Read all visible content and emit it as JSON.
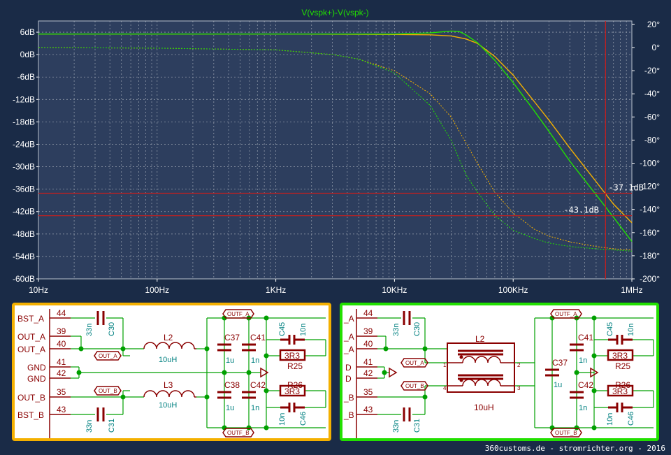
{
  "chart_data": {
    "type": "line",
    "title": "V(vspk+)-V(vspk-)",
    "x_scale": "log",
    "xlim": [
      10,
      1000000
    ],
    "x_ticks": [
      {
        "value": 10,
        "label": "10Hz"
      },
      {
        "value": 100,
        "label": "100Hz"
      },
      {
        "value": 1000,
        "label": "1KHz"
      },
      {
        "value": 10000,
        "label": "10KHz"
      },
      {
        "value": 100000,
        "label": "100KHz"
      },
      {
        "value": 1000000,
        "label": "1MHz"
      }
    ],
    "ylim": [
      -60,
      9
    ],
    "y_ticks": [
      {
        "value": 6,
        "label": "6dB"
      },
      {
        "value": 0,
        "label": "0dB"
      },
      {
        "value": -6,
        "label": "-6dB"
      },
      {
        "value": -12,
        "label": "-12dB"
      },
      {
        "value": -18,
        "label": "-18dB"
      },
      {
        "value": -24,
        "label": "-24dB"
      },
      {
        "value": -30,
        "label": "-30dB"
      },
      {
        "value": -36,
        "label": "-36dB"
      },
      {
        "value": -42,
        "label": "-42dB"
      },
      {
        "value": -48,
        "label": "-48dB"
      },
      {
        "value": -54,
        "label": "-54dB"
      },
      {
        "value": -60,
        "label": "-60dB"
      }
    ],
    "y2lim": [
      -200,
      23
    ],
    "y2_ticks": [
      {
        "value": 20,
        "label": "20°"
      },
      {
        "value": 0,
        "label": "0°"
      },
      {
        "value": -20,
        "label": "-20°"
      },
      {
        "value": -40,
        "label": "-40°"
      },
      {
        "value": -60,
        "label": "-60°"
      },
      {
        "value": -80,
        "label": "-80°"
      },
      {
        "value": -100,
        "label": "-100°"
      },
      {
        "value": -120,
        "label": "-120°"
      },
      {
        "value": -140,
        "label": "-140°"
      },
      {
        "value": -160,
        "label": "-160°"
      },
      {
        "value": -180,
        "label": "-180°"
      },
      {
        "value": -200,
        "label": "-200°"
      }
    ],
    "grid": true,
    "series": [
      {
        "color": "#f4b000",
        "style": "solid",
        "axis": "magnitude",
        "x": [
          10,
          1000,
          10000,
          20000,
          30000,
          40000,
          50000,
          70000,
          100000,
          150000,
          200000,
          300000,
          500000,
          700000,
          1000000
        ],
        "y": [
          5.5,
          5.5,
          5.4,
          5.3,
          5.0,
          4.2,
          3.0,
          -0.5,
          -5.5,
          -12.5,
          -17.5,
          -25,
          -34,
          -40,
          -45
        ]
      },
      {
        "color": "#22e000",
        "style": "solid",
        "axis": "magnitude",
        "x": [
          10,
          1000,
          10000,
          20000,
          30000,
          35000,
          40000,
          50000,
          70000,
          100000,
          150000,
          200000,
          300000,
          500000,
          700000,
          1000000
        ],
        "y": [
          5.5,
          5.5,
          5.5,
          5.8,
          6.3,
          6.2,
          5.3,
          3.2,
          -1.5,
          -7.5,
          -15,
          -20.5,
          -28.5,
          -37.5,
          -43.5,
          -50
        ]
      },
      {
        "color": "#f4b000",
        "style": "dashed",
        "axis": "phase",
        "x": [
          10,
          100,
          1000,
          3000,
          5000,
          10000,
          20000,
          30000,
          50000,
          70000,
          100000,
          150000,
          200000,
          300000,
          500000,
          700000,
          1000000
        ],
        "y": [
          0,
          -0.5,
          -2,
          -6,
          -10,
          -20,
          -40,
          -60,
          -100,
          -125,
          -143,
          -157,
          -163,
          -168,
          -172,
          -174,
          -175
        ]
      },
      {
        "color": "#22e000",
        "style": "dashed",
        "axis": "phase",
        "x": [
          10,
          100,
          1000,
          3000,
          5000,
          10000,
          20000,
          30000,
          40000,
          50000,
          70000,
          100000,
          150000,
          200000,
          300000,
          500000,
          700000,
          1000000
        ],
        "y": [
          0,
          -0.5,
          -2,
          -6,
          -10,
          -22,
          -50,
          -80,
          -110,
          -125,
          -145,
          -158,
          -165,
          -169,
          -172,
          -174,
          -175,
          -176
        ]
      }
    ],
    "cursor_x": 600000,
    "cursors_y": [
      {
        "value": -37.1,
        "label": "-37.1dB"
      },
      {
        "value": -43.1,
        "label": "-43.1dB"
      }
    ]
  },
  "theme": {
    "background": "#1a2b47",
    "plot_background": "#2d3e5e",
    "grid": "#8e98a8",
    "cursor": "#c02020",
    "title": "#22e000"
  },
  "schematic_left": {
    "pins": [
      {
        "num": "44",
        "label": "BST_A"
      },
      {
        "num": "39",
        "label": "OUT_A"
      },
      {
        "num": "40",
        "label": "OUT_A"
      },
      {
        "num": "41",
        "label": "GND"
      },
      {
        "num": "42",
        "label": "GND"
      },
      {
        "num": "35",
        "label": "OUT_B"
      },
      {
        "num": "43",
        "label": "BST_B"
      }
    ],
    "L2": {
      "ref": "L2",
      "value": "10uH"
    },
    "L3": {
      "ref": "L3",
      "value": "10uH"
    },
    "C30": {
      "ref": "C30",
      "value": "33n"
    },
    "C31": {
      "ref": "C31",
      "value": "33n"
    },
    "C37": {
      "ref": "C37",
      "value": "1u"
    },
    "C38": {
      "ref": "C38",
      "value": "1u"
    },
    "C41": {
      "ref": "C41",
      "value": "1n"
    },
    "C42": {
      "ref": "C42",
      "value": "1n"
    },
    "C45": {
      "ref": "C45",
      "value": "10n"
    },
    "C46": {
      "ref": "C46",
      "value": "10n"
    },
    "R25": {
      "ref": "R25",
      "value": "3R3"
    },
    "R26": {
      "ref": "R26",
      "value": "3R3"
    },
    "tags": {
      "outf_a": "OUTF_A",
      "outf_b": "OUTF_B",
      "out_a": "OUT_A",
      "out_b": "OUT_B"
    }
  },
  "schematic_right": {
    "pins": [
      {
        "num": "44",
        "label": "_A"
      },
      {
        "num": "39",
        "label": "_A"
      },
      {
        "num": "40",
        "label": "_A"
      },
      {
        "num": "41",
        "label": "D"
      },
      {
        "num": "42",
        "label": "D"
      },
      {
        "num": "35",
        "label": "_B"
      },
      {
        "num": "43",
        "label": "_B"
      }
    ],
    "L2": {
      "ref": "L2",
      "value": "10uH",
      "pin1": "1",
      "pin2": "2",
      "pin3": "3",
      "pin4": "4"
    },
    "C30": {
      "ref": "C30",
      "value": "33n"
    },
    "C31": {
      "ref": "C31",
      "value": "33n"
    },
    "C37": {
      "ref": "C37",
      "value": "1u"
    },
    "C41": {
      "ref": "C41",
      "value": "1n"
    },
    "C42": {
      "ref": "C42",
      "value": "1n"
    },
    "C45": {
      "ref": "C45",
      "value": "10n"
    },
    "C46": {
      "ref": "C46",
      "value": "10n"
    },
    "R25": {
      "ref": "R25",
      "value": "3R3"
    },
    "R26": {
      "ref": "R26",
      "value": "3R3"
    },
    "tags": {
      "outf_a": "OUTF_A",
      "outf_b": "OUTF_B",
      "out_a": "OUT_A",
      "out_b": "OUT_B"
    }
  },
  "footer": "360customs.de - stromrichter.org - 2016"
}
